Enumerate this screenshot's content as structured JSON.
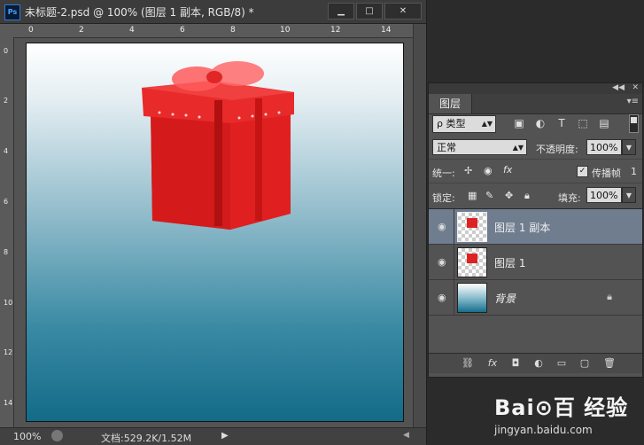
{
  "window": {
    "title": "未标题-2.psd @ 100% (图层 1 副本, RGB/8) *",
    "app_icon": "Ps",
    "minimize": "▁",
    "maximize": "□",
    "close": "✕"
  },
  "ruler_h": [
    "0",
    "2",
    "4",
    "6",
    "8",
    "10",
    "12",
    "14"
  ],
  "ruler_v": [
    "0",
    "2",
    "4",
    "6",
    "8",
    "10",
    "12",
    "14"
  ],
  "status": {
    "zoom": "100%",
    "doc_info": "文档:529.2K/1.52M",
    "arrow": "▶"
  },
  "layers_panel": {
    "tab": "图层",
    "filter_kind": "ρ 类型",
    "blend_mode": "正常",
    "opacity_label": "不透明度:",
    "opacity_value": "100%",
    "unify_label": "统一:",
    "propagate_label": "传播帧",
    "propagate_value": "1",
    "lock_label": "锁定:",
    "fill_label": "填充:",
    "fill_value": "100%",
    "layers": [
      {
        "name": "图层 1 副本",
        "selected": true
      },
      {
        "name": "图层 1",
        "selected": false
      },
      {
        "name": "背景",
        "selected": false,
        "locked": true
      }
    ]
  },
  "watermark": {
    "logo": "Bai⊙百 经验",
    "url": "jingyan.baidu.com"
  },
  "colors": {
    "selected_layer": "#6f7d8f",
    "gift_red": "#d41a1a",
    "canvas_top": "#ffffff",
    "canvas_bottom": "#136b88"
  }
}
